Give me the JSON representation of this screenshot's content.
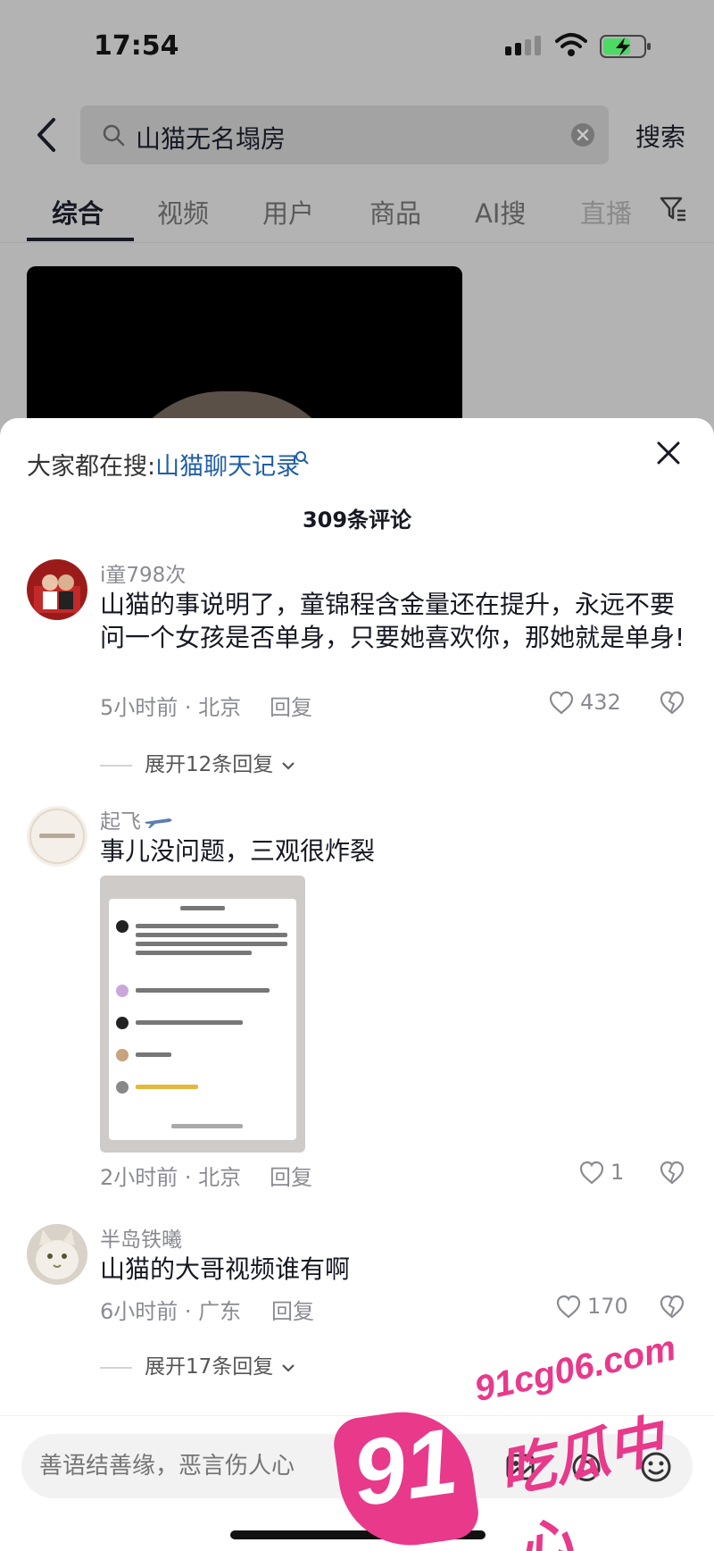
{
  "status_bar": {
    "time": "17:54"
  },
  "search": {
    "query": "山猫无名塌房",
    "submit_label": "搜索"
  },
  "tabs": [
    {
      "label": "综合"
    },
    {
      "label": "视频"
    },
    {
      "label": "用户"
    },
    {
      "label": "商品"
    },
    {
      "label": "AI搜"
    },
    {
      "label": "直播"
    }
  ],
  "comments_panel": {
    "hot_search_label": "大家都在搜:",
    "hot_search_link": "山猫聊天记录",
    "count_label": "309条评论",
    "comments": [
      {
        "username": "i童798次",
        "text": "山猫的事说明了，童锦程含金量还在提升，永远不要问一个女孩是否单身，只要她喜欢你，那她就是单身!",
        "meta": "5小时前 · 北京",
        "reply_label": "回复",
        "likes": "432",
        "expand_label": "展开12条回复"
      },
      {
        "username": "起飞",
        "text": "事儿没问题，三观很炸裂",
        "meta": "2小时前 · 北京",
        "reply_label": "回复",
        "likes": "1"
      },
      {
        "username": "半岛铁曦",
        "text": "山猫的大哥视频谁有啊",
        "meta": "6小时前 · 广东",
        "reply_label": "回复",
        "likes": "170",
        "expand_label": "展开17条回复"
      }
    ]
  },
  "input": {
    "placeholder": "善语结善缘，恶言伤人心"
  },
  "watermark": {
    "number": "91",
    "url": "91cg06.com",
    "name": "吃瓜中心"
  },
  "colors": {
    "link": "#1f5ea8",
    "watermark": "#e8398b",
    "text": "#161823",
    "muted": "#8a8b91"
  }
}
